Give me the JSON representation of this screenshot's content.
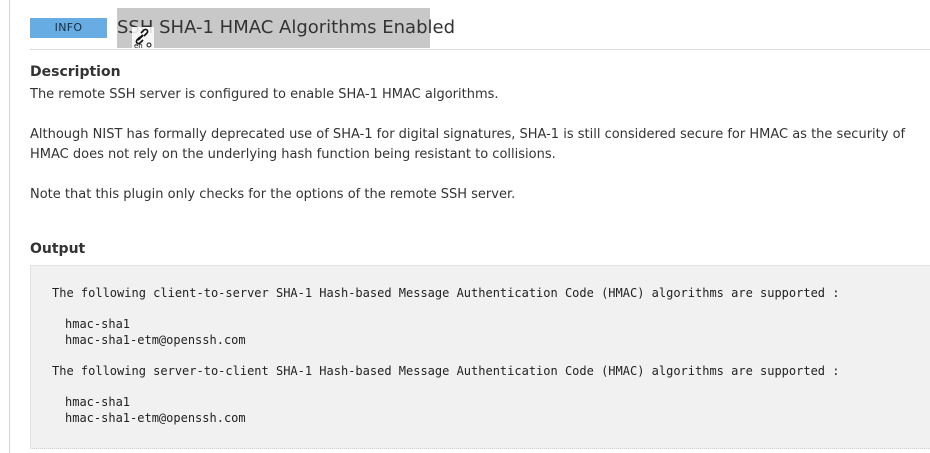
{
  "header": {
    "severity": "INFO",
    "title": "SSH SHA-1 HMAC Algorithms Enabled",
    "severity_color": "#67ade3",
    "title_highlight_color": "#c8c8c8"
  },
  "description": {
    "heading": "Description",
    "paragraphs": [
      "The remote SSH server is configured to enable SHA-1 HMAC algorithms.",
      "Although NIST has formally deprecated use of SHA-1 for digital signatures, SHA-1 is still considered secure for HMAC as the security of HMAC does not rely on the underlying hash function being resistant to collisions.",
      "Note that this plugin only checks for the options of the remote SSH server."
    ]
  },
  "output": {
    "heading": "Output",
    "blocks": [
      {
        "intro": "The following client-to-server SHA-1 Hash-based Message Authentication Code (HMAC) algorithms are supported :",
        "items": [
          "hmac-sha1",
          "hmac-sha1-etm@openssh.com"
        ]
      },
      {
        "intro": "The following server-to-client SHA-1 Hash-based Message Authentication Code (HMAC) algorithms are supported :",
        "items": [
          "hmac-sha1",
          "hmac-sha1-etm@openssh.com"
        ]
      }
    ]
  },
  "icons": {
    "cursor": "link-select-cursor-icon"
  }
}
